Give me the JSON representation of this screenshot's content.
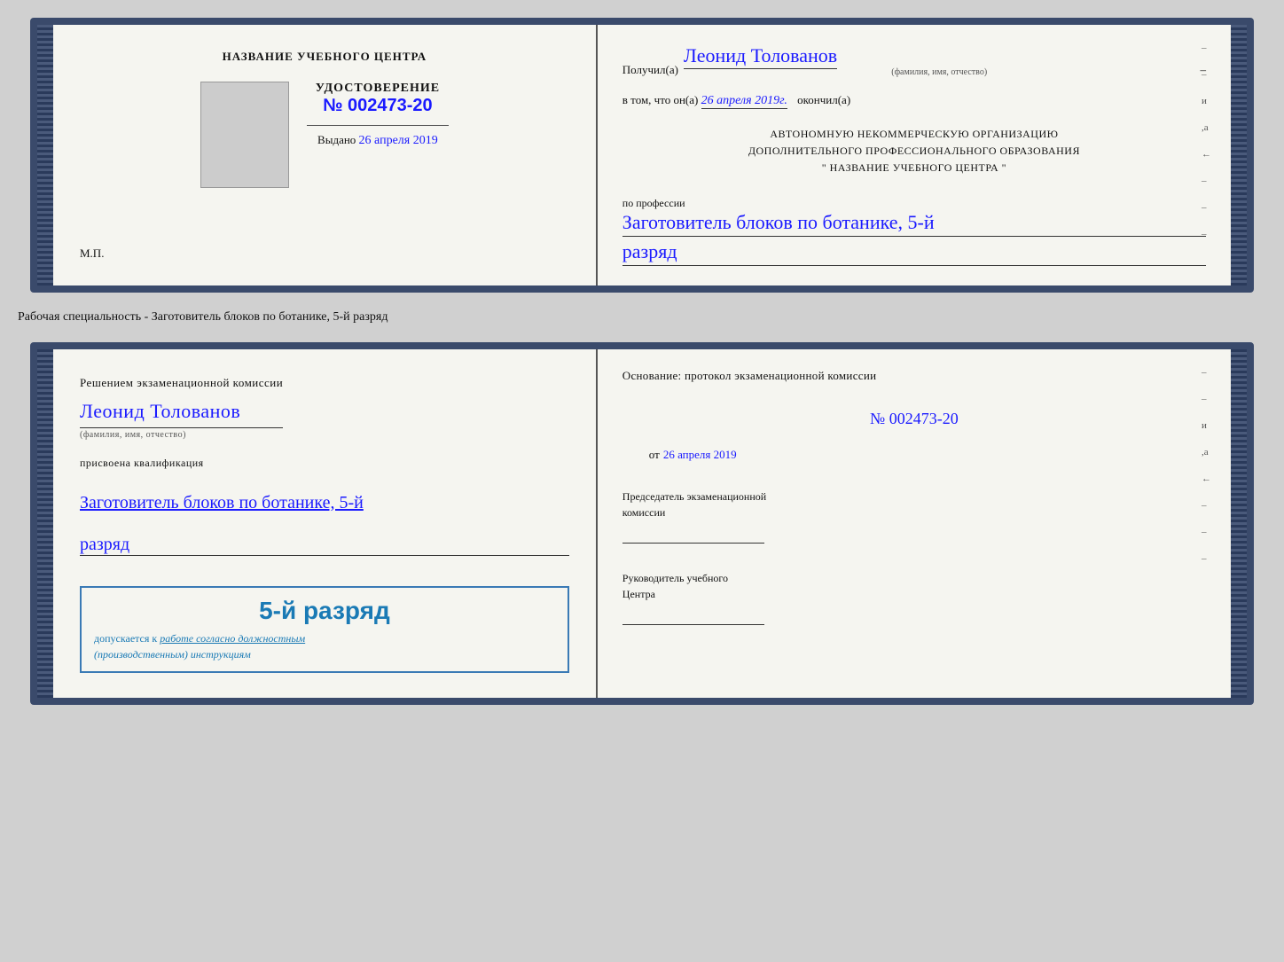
{
  "top_doc": {
    "left": {
      "training_center": "НАЗВАНИЕ УЧЕБНОГО ЦЕНТРА",
      "cert_label": "УДОСТОВЕРЕНИЕ",
      "cert_number_prefix": "№",
      "cert_number": "002473-20",
      "issued_label": "Выдано",
      "issued_date": "26 апреля 2019",
      "mp_label": "М.П."
    },
    "right": {
      "received_prefix": "Получил(а)",
      "recipient_name": "Леонид Толованов",
      "fio_label": "(фамилия, имя, отчество)",
      "date_prefix": "в том, что он(а)",
      "completion_date": "26 апреля 2019г.",
      "completed_suffix": "окончил(а)",
      "org_line1": "АВТОНОМНУЮ НЕКОММЕРЧЕСКУЮ ОРГАНИЗАЦИЮ",
      "org_line2": "ДОПОЛНИТЕЛЬНОГО ПРОФЕССИОНАЛЬНОГО ОБРАЗОВАНИЯ",
      "org_line3": "\"  НАЗВАНИЕ УЧЕБНОГО ЦЕНТРА  \"",
      "profession_prefix": "по профессии",
      "profession": "Заготовитель блоков по ботанике, 5-й",
      "rank": "разряд",
      "side_marks": [
        "-",
        "-",
        "-",
        "и",
        ",а",
        "←",
        "-",
        "-",
        "-",
        "-"
      ]
    }
  },
  "separator": {
    "label": "Рабочая специальность - Заготовитель блоков по ботанике, 5-й разряд"
  },
  "bottom_doc": {
    "left": {
      "decision_text": "Решением экзаменационной комиссии",
      "person_name": "Леонид Толованов",
      "fio_label": "(фамилия, имя, отчество)",
      "qualified_text": "присвоена квалификация",
      "qualification": "Заготовитель блоков по ботанике, 5-й",
      "rank": "разряд",
      "stamp_rank": "5-й разряд",
      "stamp_admit_prefix": "допускается к",
      "stamp_admit_link": "работе согласно должностным",
      "stamp_admit_suffix": "(производственным) инструкциям"
    },
    "right": {
      "basis_text": "Основание: протокол экзаменационной комиссии",
      "protocol_prefix": "№",
      "protocol_number": "002473-20",
      "from_prefix": "от",
      "from_date": "26 апреля 2019",
      "chairman_role1": "Председатель экзаменационной",
      "chairman_role2": "комиссии",
      "director_role1": "Руководитель учебного",
      "director_role2": "Центра",
      "side_marks": [
        "-",
        "-",
        "-",
        "и",
        ",а",
        "←",
        "-",
        "-",
        "-",
        "-"
      ]
    }
  }
}
